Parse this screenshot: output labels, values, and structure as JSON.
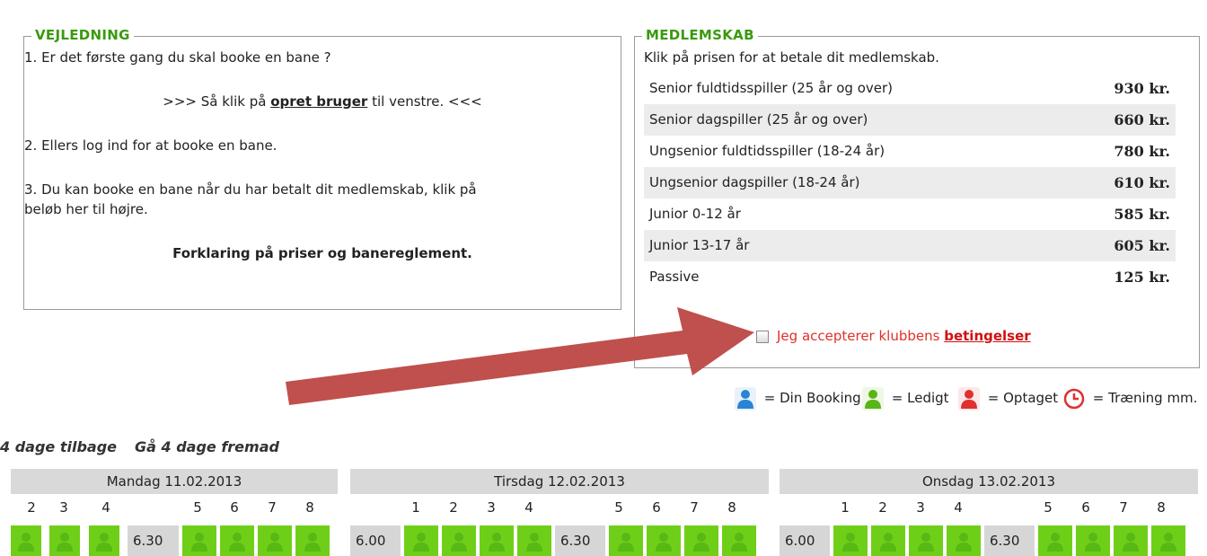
{
  "guide": {
    "title": "VEJLEDNING",
    "line1": "1. Er det første gang du skal booke en bane ?",
    "line2_pre": ">>> Så klik på ",
    "line2_link": "opret bruger",
    "line2_post": " til venstre. <<<",
    "line3": "2. Ellers log ind for at booke en bane.",
    "line4a": "3. Du kan booke en bane når du har betalt dit medlemskab, klik på",
    "line4b": "beløb her til højre.",
    "explain_link": "Forklaring på priser og banereglement."
  },
  "membership": {
    "title": "MEDLEMSKAB",
    "intro": "Klik på prisen for at betale dit medlemskab.",
    "rows": [
      {
        "name": "Senior fuldtidsspiller (25 år og over)",
        "price": "930 kr."
      },
      {
        "name": "Senior dagspiller (25 år og over)",
        "price": "660 kr."
      },
      {
        "name": "Ungsenior fuldtidsspiller (18-24 år)",
        "price": "780 kr."
      },
      {
        "name": "Ungsenior dagspiller (18-24 år)",
        "price": "610 kr."
      },
      {
        "name": "Junior 0-12 år",
        "price": "585 kr."
      },
      {
        "name": "Junior 13-17 år",
        "price": "605 kr."
      },
      {
        "name": "Passive",
        "price": "125 kr."
      }
    ],
    "accept_text": "Jeg accepterer klubbens ",
    "accept_link": "betingelser"
  },
  "legend": {
    "your_booking": "= Din Booking",
    "free": "= Ledigt",
    "taken": "= Optaget",
    "training": "= Træning mm."
  },
  "nav": {
    "back": "4 dage tilbage",
    "forward": "Gå 4 dage fremad"
  },
  "days": [
    {
      "label": "Mandag 11.02.2013"
    },
    {
      "label": "Tirsdag 12.02.2013"
    },
    {
      "label": "Onsdag 13.02.2013"
    }
  ],
  "court_numbers": {
    "mon": [
      "2",
      "3",
      "4",
      "5",
      "6",
      "7",
      "8"
    ],
    "tue": [
      "1",
      "2",
      "3",
      "4",
      "5",
      "6",
      "7",
      "8"
    ],
    "wed": [
      "1",
      "2",
      "3",
      "4",
      "5",
      "6",
      "7",
      "8"
    ]
  },
  "times": {
    "t600": "6.00",
    "t630": "6.30"
  },
  "colors": {
    "accent_green": "#3a9a0e",
    "free": "#6fcf18",
    "booking": "#2a84d6",
    "taken": "#e03030",
    "arrow": "#c0504d"
  }
}
